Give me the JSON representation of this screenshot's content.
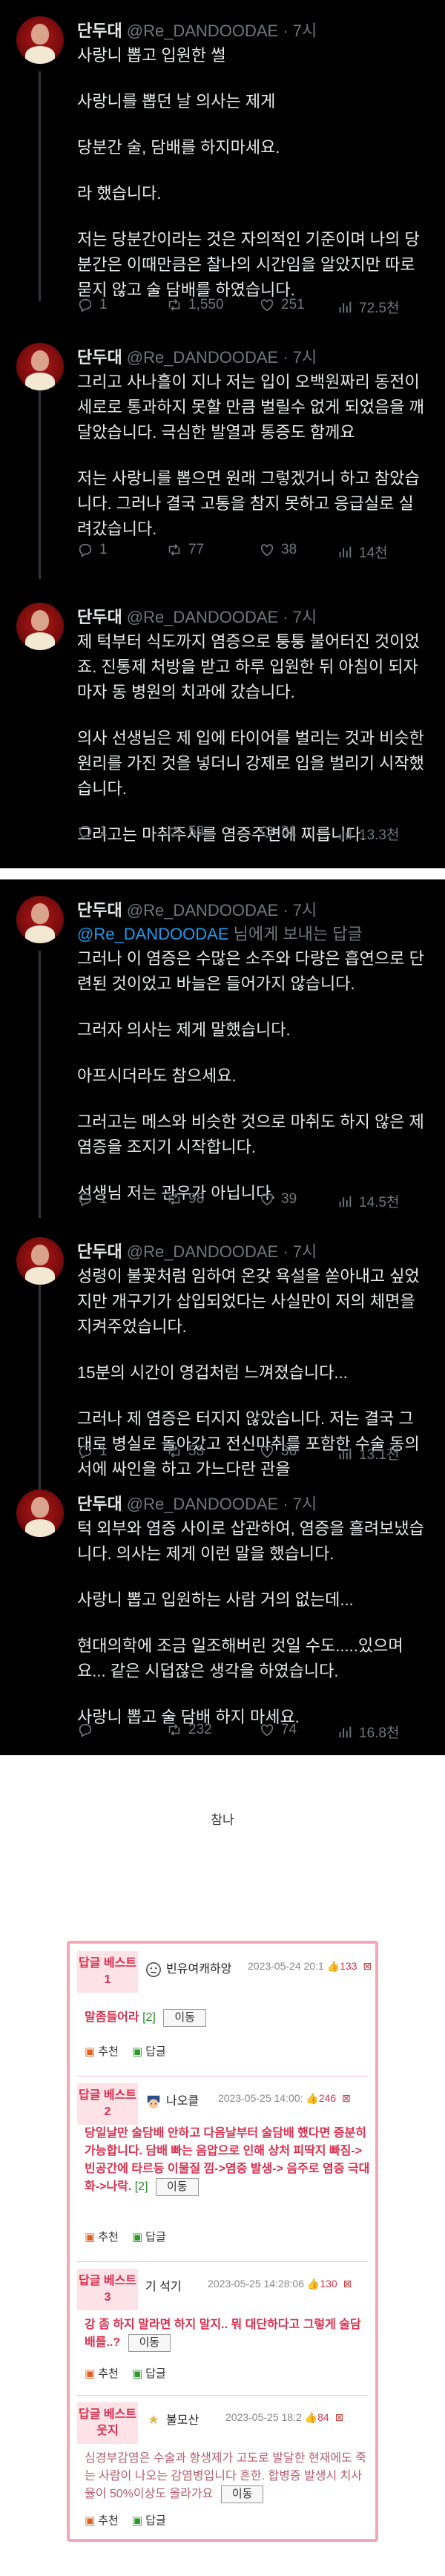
{
  "tweets": [
    {
      "name": "단두대",
      "handle": "@Re_DANDOODAE · 7시",
      "paragraphs": [
        "사랑니 뽑고 입원한 썰",
        "사랑니를 뽑던 날 의사는 제게",
        "당분간 술, 담배를 하지마세요.",
        "라 했습니다.",
        "저는 당분간이라는 것은 자의적인 기준이며 나의 당분간은 이때만큼은 찰나의 시간임을 알았지만 따로 묻지 않고 술 담배를 하였습니다."
      ],
      "stats": {
        "reply": "1",
        "retweet": "1,550",
        "like": "251",
        "views": "72.5천"
      }
    },
    {
      "name": "단두대",
      "handle": "@Re_DANDOODAE · 7시",
      "paragraphs": [
        "그리고 사나흘이 지나 저는 입이 오백원짜리 동전이 세로로 통과하지 못할 만큼 벌릴수 없게 되었음을 깨달았습니다. 극심한 발열과 통증도 함께요",
        "저는 사랑니를 뽑으면 원래 그렇겠거니 하고 참았습니다. 그러나 결국 고통을 참지 못하고 응급실로 실려갔습니다."
      ],
      "stats": {
        "reply": "1",
        "retweet": "77",
        "like": "38",
        "views": "14천"
      }
    },
    {
      "name": "단두대",
      "handle": "@Re_DANDOODAE · 7시",
      "paragraphs": [
        "제 턱부터 식도까지 염증으로 퉁퉁 불어터진 것이었죠. 진통제 처방을 받고 하루 입원한 뒤 아침이 되자마자 동 병원의 치과에 갔습니다.",
        "의사 선생님은 제 입에 타이어를 벌리는 것과 비슷한 원리를 가진 것을 넣더니 강제로 입을 벌리기 시작했습니다.",
        "그러고는 마취주사를 염증주변에 찌릅니다."
      ],
      "stats": {
        "reply": "1",
        "retweet": "58",
        "like": "31",
        "views": "13.3천"
      }
    },
    {
      "name": "단두대",
      "handle": "@Re_DANDOODAE · 7시",
      "replyto_link": "@Re_DANDOODAE",
      "replyto_rest": " 님에게 보내는 답글",
      "paragraphs": [
        "그러나 이 염증은 수많은 소주와 다량은 흡연으로 단련된 것이었고 바늘은 들어가지 않습니다.",
        "그러자 의사는 제게 말했습니다.",
        "아프시더라도 참으세요.",
        "그러고는 메스와 비슷한 것으로 마취도 하지 않은 제 염증을 조지기 시작합니다.",
        "선생님 저는 관우가 아닙니다."
      ],
      "stats": {
        "reply": "1",
        "retweet": "98",
        "like": "39",
        "views": "14.5천"
      }
    },
    {
      "name": "단두대",
      "handle": "@Re_DANDOODAE · 7시",
      "paragraphs": [
        "성령이 불꽃처럼 임하여 온갖 욕설을 쏟아내고 싶었지만 개구기가 삽입되었다는 사실만이 저의 체면을 지켜주었습니다.",
        "15분의 시간이 영겁처럼 느껴졌습니다...",
        "그러나 제 염증은 터지지 않았습니다. 저는 결국 그대로 병실로 돌아갔고 전신마취를 포함한 수술 동의서에 싸인을 하고 가느다란 관을"
      ],
      "stats": {
        "reply": "1",
        "retweet": "53",
        "like": "36",
        "views": "13.1천"
      }
    },
    {
      "name": "단두대",
      "handle": "@Re_DANDOODAE · 7시",
      "paragraphs": [
        "턱 외부와 염증 사이로 삽관하여, 염증을 흘려보냈습니다. 의사는 제게 이런 말을 했습니다.",
        "사랑니 뽑고 입원하는 사람 거의 없는데...",
        "현대의학에 조금 일조해버린 것일 수도.....있으며요... 같은 시덥잖은 생각을 하였습니다.",
        "사랑니 뽑고 술 담배 하지 마세요."
      ],
      "stats": {
        "reply": "",
        "retweet": "232",
        "like": "74",
        "views": "16.8천"
      }
    }
  ],
  "caption": "참나",
  "comments": {
    "more_label": "이동",
    "recommend_label": "추천",
    "reply_label": "답글",
    "items": [
      {
        "badge": "답글 베스트1",
        "user": "빈유여캐하앙",
        "meta": "2023-05-24 20:1",
        "score": "133",
        "text": "말좀들어라",
        "sub": "[2]"
      },
      {
        "badge": "답글 베스트2",
        "user": "나오클",
        "meta": "2023-05-25 14:00:",
        "score": "246",
        "text": "당일날만 술담배 안하고 다음날부터 술담배 했다면 증분히 가능합니다. 담배 빠는 음압으로 인해 상처 피딱지 빠짐->빈공간에 타르등 이물질 낌->염증 발생-> 음주로 염증 극대화->나락.",
        "sub": "[2]"
      },
      {
        "badge": "답글 베스트3",
        "user": "기 석기",
        "meta": "2023-05-25 14:28:06",
        "score": "130",
        "text": "강 좀 하지 말라면 하지 말지.. 뭐 대단하다고 그렇게 술담배를..?",
        "sub": ""
      },
      {
        "badge": "답글 베스트 웃지",
        "user": "불모산",
        "meta": "2023-05-25 18:2",
        "score": "84",
        "text": "심경부감염은 수술과 항생제가 고도로 발달한 현재에도 죽는 사람이 나오는 감염병입니다 흔한. 합병증 발생시 치사율이 50%이상도 올라가요",
        "sub": ""
      }
    ]
  }
}
